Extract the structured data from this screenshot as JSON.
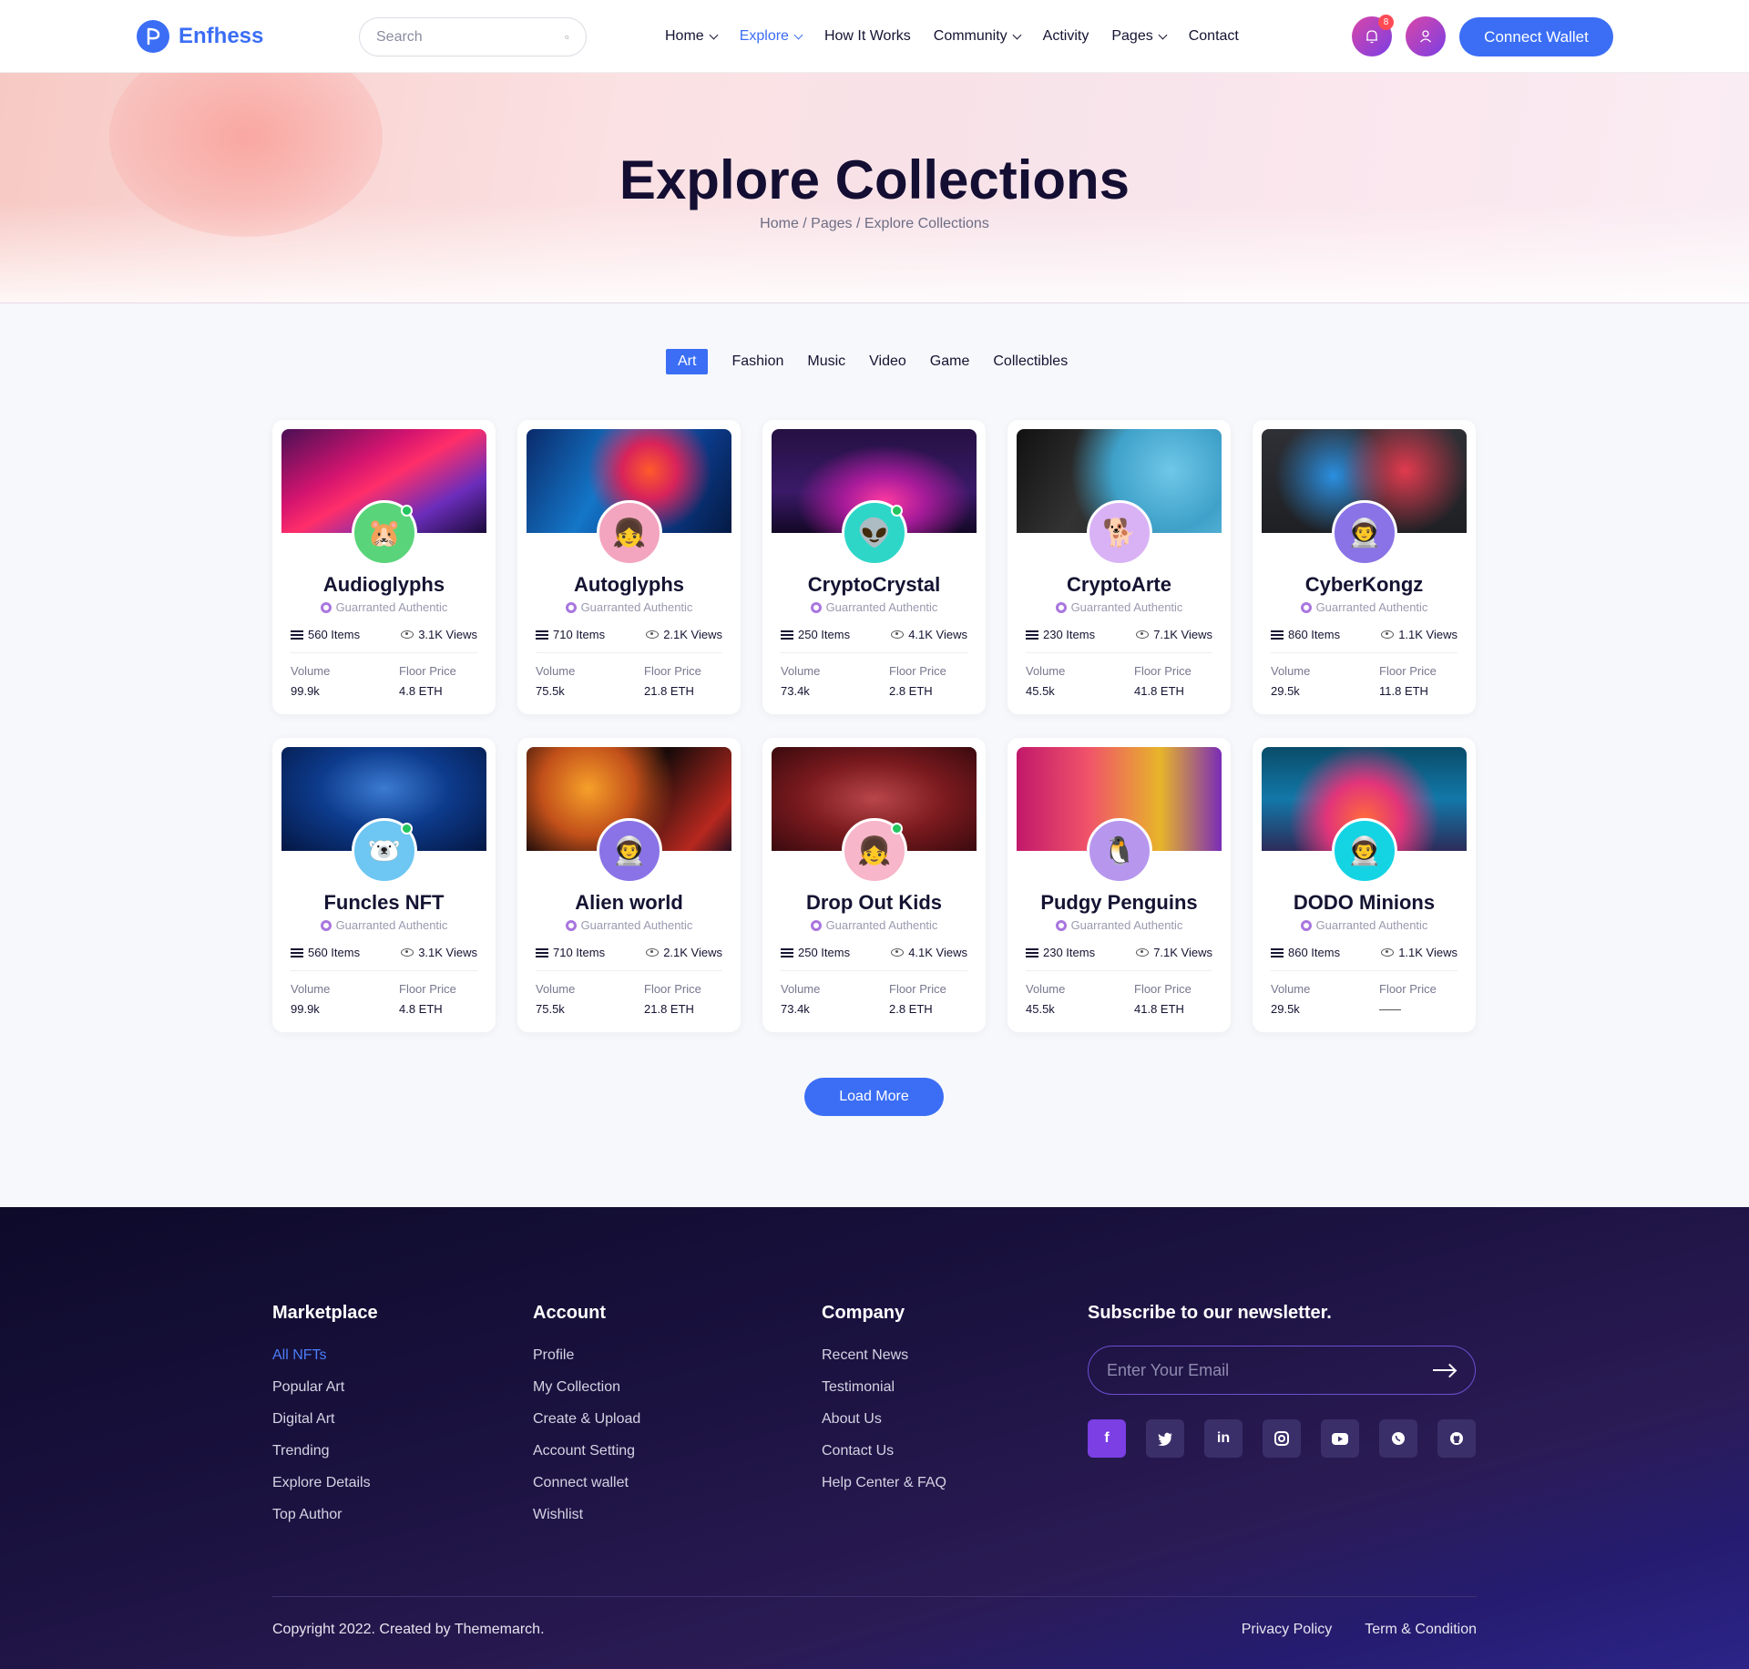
{
  "header": {
    "logo_text": "Enfhess",
    "search_placeholder": "Search",
    "nav": [
      {
        "label": "Home",
        "dropdown": true
      },
      {
        "label": "Explore",
        "dropdown": true,
        "active": true
      },
      {
        "label": "How It Works",
        "dropdown": false
      },
      {
        "label": "Community",
        "dropdown": true
      },
      {
        "label": "Activity",
        "dropdown": false
      },
      {
        "label": "Pages",
        "dropdown": true
      },
      {
        "label": "Contact",
        "dropdown": false
      }
    ],
    "notification_count": "8",
    "connect_label": "Connect Wallet"
  },
  "hero": {
    "title": "Explore Collections",
    "breadcrumb": "Home / Pages / Explore Collections"
  },
  "tabs": [
    "Art",
    "Fashion",
    "Music",
    "Video",
    "Game",
    "Collectibles"
  ],
  "active_tab": "Art",
  "authentic_label": "Guarranted Authentic",
  "volume_label": "Volume",
  "floor_label": "Floor Price",
  "collections": [
    {
      "name": "Audioglyphs",
      "items": "560 Items",
      "views": "3.1K Views",
      "volume": "99.9k",
      "floor": "4.8 ETH",
      "online": true,
      "avatar_icon": "hamster-icon"
    },
    {
      "name": "Autoglyphs",
      "items": "710 Items",
      "views": "2.1K Views",
      "volume": "75.5k",
      "floor": "21.8 ETH",
      "online": false,
      "avatar_icon": "girl-icon"
    },
    {
      "name": "CryptoCrystal",
      "items": "250 Items",
      "views": "4.1K Views",
      "volume": "73.4k",
      "floor": "2.8 ETH",
      "online": true,
      "avatar_icon": "alien-icon"
    },
    {
      "name": "CryptoArte",
      "items": "230 Items",
      "views": "7.1K Views",
      "volume": "45.5k",
      "floor": "41.8 ETH",
      "online": false,
      "avatar_icon": "shiba-icon"
    },
    {
      "name": "CyberKongz",
      "items": "860 Items",
      "views": "1.1K Views",
      "volume": "29.5k",
      "floor": "11.8 ETH",
      "online": false,
      "avatar_icon": "astronaut-icon"
    },
    {
      "name": "Funcles NFT",
      "items": "560 Items",
      "views": "3.1K Views",
      "volume": "99.9k",
      "floor": "4.8 ETH",
      "online": true,
      "avatar_icon": "bear-icon"
    },
    {
      "name": "Alien world",
      "items": "710 Items",
      "views": "2.1K Views",
      "volume": "75.5k",
      "floor": "21.8 ETH",
      "online": false,
      "avatar_icon": "astronaut-icon"
    },
    {
      "name": "Drop Out Kids",
      "items": "250 Items",
      "views": "4.1K Views",
      "volume": "73.4k",
      "floor": "2.8 ETH",
      "online": true,
      "avatar_icon": "girl-icon"
    },
    {
      "name": "Pudgy Penguins",
      "items": "230 Items",
      "views": "7.1K Views",
      "volume": "45.5k",
      "floor": "41.8 ETH",
      "online": false,
      "avatar_icon": "penguin-icon"
    },
    {
      "name": "DODO Minions",
      "items": "860 Items",
      "views": "1.1K Views",
      "volume": "29.5k",
      "floor": "",
      "online": false,
      "avatar_icon": "astronaut-icon"
    }
  ],
  "load_more_label": "Load More",
  "footer": {
    "columns": [
      {
        "title": "Marketplace",
        "links": [
          "All NFTs",
          "Popular Art",
          "Digital Art",
          "Trending",
          "Explore Details",
          "Top Author"
        ]
      },
      {
        "title": "Account",
        "links": [
          "Profile",
          "My Collection",
          "Create & Upload",
          "Account Setting",
          "Connect wallet",
          "Wishlist"
        ]
      },
      {
        "title": "Company",
        "links": [
          "Recent News",
          "Testimonial",
          "About Us",
          "Contact Us",
          "Help Center & FAQ"
        ]
      }
    ],
    "newsletter_title": "Subscribe to our newsletter.",
    "email_placeholder": "Enter Your Email",
    "socials": [
      "facebook-icon",
      "twitter-icon",
      "linkedin-icon",
      "instagram-icon",
      "youtube-icon",
      "whatsapp-icon",
      "github-icon"
    ],
    "copyright": "Copyright 2022. Created by Thememarch.",
    "legal_links": [
      "Privacy Policy",
      "Term & Condition"
    ]
  },
  "colors": {
    "accent": "#3b6ef5",
    "brand_gradient_start": "#d946a8",
    "brand_gradient_end": "#7b3fe4"
  }
}
